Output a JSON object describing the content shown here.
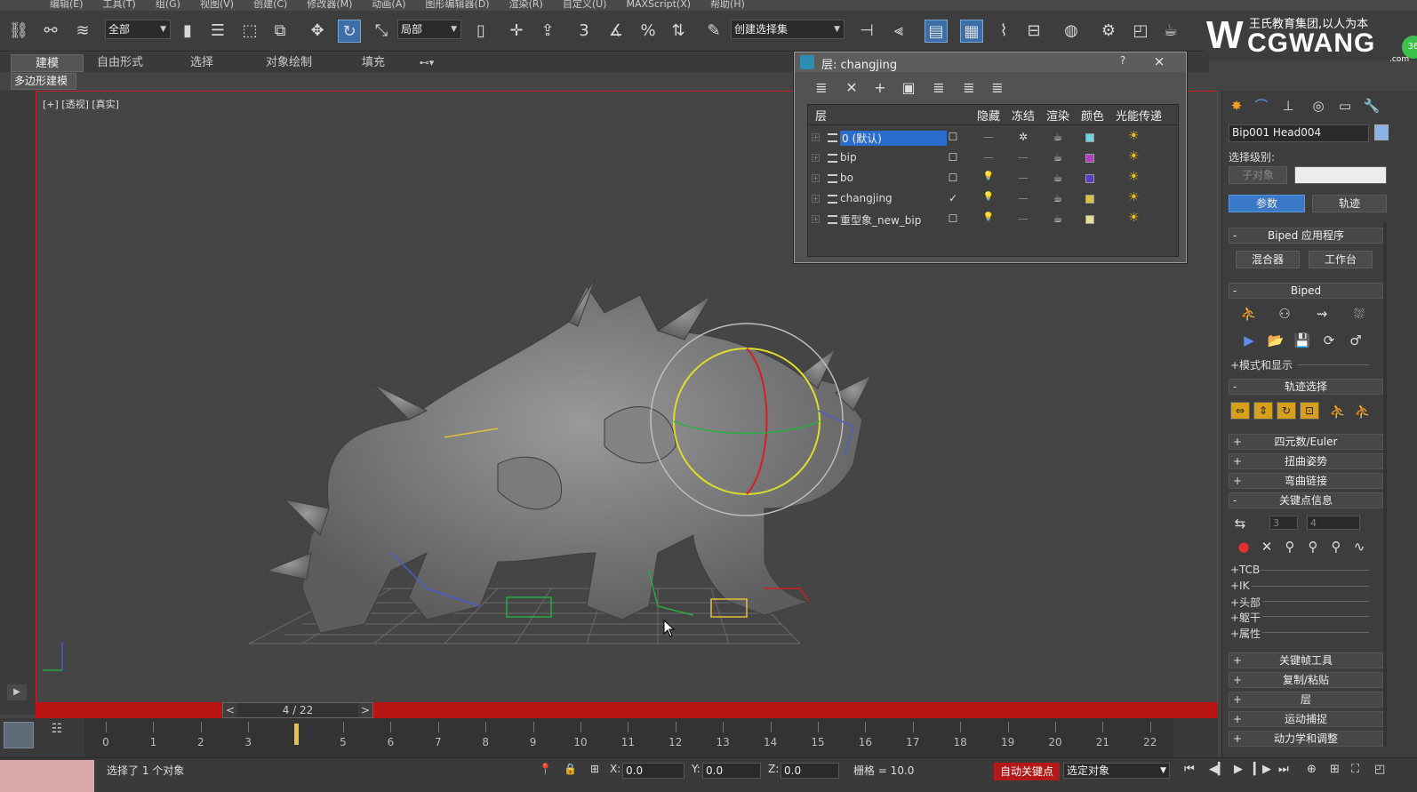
{
  "menu": [
    "编辑(E)",
    "工具(T)",
    "组(G)",
    "视图(V)",
    "创建(C)",
    "修改器(M)",
    "动画(A)",
    "图形编辑器(D)",
    "渲染(R)",
    "自定义(U)",
    "MAXScript(X)",
    "帮助(H)"
  ],
  "toolbar": {
    "selection_filter": "全部",
    "coord_system": "局部",
    "named_selection": "创建选择集",
    "snap_label": "3"
  },
  "logo": {
    "slogan": "王氏教育集团,以人为本",
    "name": "CGWANG",
    "domain": ".com",
    "badge": "36"
  },
  "ribbon": {
    "tabs": [
      "建模",
      "自由形式",
      "选择",
      "对象绘制",
      "填充"
    ],
    "active_tab": "建模",
    "sub_label": "多边形建模"
  },
  "viewport": {
    "label": "[+] [透视] [真实]"
  },
  "layer_dialog": {
    "title": "层: changjing",
    "help": "?",
    "close": "×",
    "columns": [
      "层",
      "隐藏",
      "冻结",
      "渲染",
      "颜色",
      "光能传递"
    ],
    "rows": [
      {
        "name": "0 (默认)",
        "selected": true,
        "hide": "☐",
        "freeze": "—",
        "freeze2": "✲",
        "color": "#6ad6e0"
      },
      {
        "name": "bip",
        "selected": false,
        "hide": "☐",
        "freeze": "—",
        "freeze2": "—",
        "color": "#b63cc2"
      },
      {
        "name": "bo",
        "selected": false,
        "hide": "☐",
        "freeze": "💡",
        "freeze2": "—",
        "color": "#5a3ac8"
      },
      {
        "name": "changjing",
        "selected": false,
        "hide": "✓",
        "freeze": "💡",
        "freeze2": "—",
        "color": "#e0c040"
      },
      {
        "name": "重型象_new_bip",
        "selected": false,
        "hide": "☐",
        "freeze": "💡",
        "freeze2": "—",
        "color": "#e6e08a"
      }
    ]
  },
  "command_panel": {
    "object_name": "Bip001 Head004",
    "selection_level": "选择级别:",
    "sub_object": "子对象",
    "params_btn": "参数",
    "track_btn": "轨迹",
    "biped_apps": "Biped 应用程序",
    "mixer": "混合器",
    "workbench": "工作台",
    "biped": "Biped",
    "mode_display": "+模式和显示",
    "track_selection": "轨迹选择",
    "quaternion": "四元数/Euler",
    "twist": "扭曲姿势",
    "bend": "弯曲链接",
    "key_info": "关键点信息",
    "key_prev": "3",
    "key_next": "4",
    "sub_items": [
      "+TCB",
      "+IK",
      "+头部",
      "+躯干",
      "+属性"
    ],
    "bottom_rolls": [
      "关键帧工具",
      "复制/粘贴",
      "层",
      "运动捕捉",
      "动力学和调整"
    ]
  },
  "timeline": {
    "slider": "4 / 22",
    "prev": "<",
    "next": ">",
    "ticks": [
      "0",
      "1",
      "2",
      "3",
      "5",
      "6",
      "7",
      "8",
      "9",
      "10",
      "11",
      "12",
      "13",
      "14",
      "15",
      "16",
      "17",
      "18",
      "19",
      "20",
      "21",
      "22"
    ]
  },
  "status": {
    "message": "选择了 1 个对象",
    "x_label": "X:",
    "x_value": "0.0",
    "y_label": "Y:",
    "y_value": "0.0",
    "z_label": "Z:",
    "z_value": "0.0",
    "grid": "栅格 = 10.0",
    "auto_key": "自动关键点",
    "selected_object": "选定对象"
  }
}
